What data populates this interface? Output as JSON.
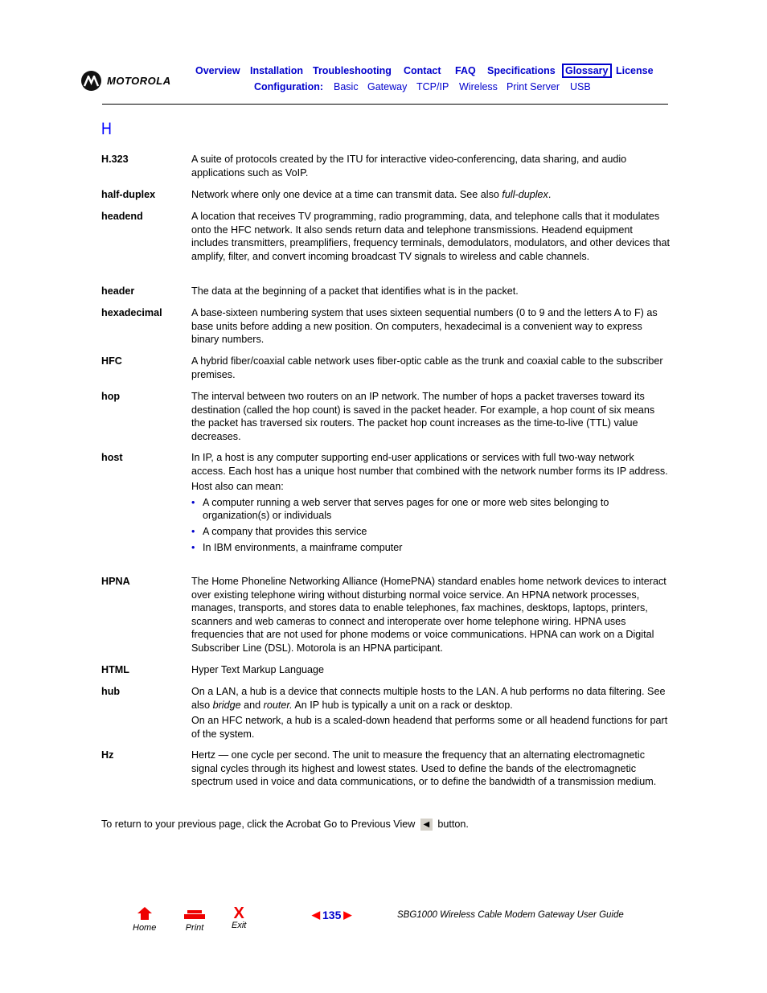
{
  "header": {
    "brand": "MOTOROLA",
    "nav_top": [
      {
        "label": "Overview"
      },
      {
        "label": "Installation"
      },
      {
        "label": "Troubleshooting"
      },
      {
        "label": "Contact"
      },
      {
        "label": "FAQ"
      },
      {
        "label": "Specifications"
      },
      {
        "label": "Glossary",
        "selected": true
      },
      {
        "label": "License"
      }
    ],
    "nav_config_label": "Configuration:",
    "nav_config": [
      {
        "label": "Basic"
      },
      {
        "label": "Gateway"
      },
      {
        "label": "TCP/IP"
      },
      {
        "label": "Wireless"
      },
      {
        "label": "Print Server"
      },
      {
        "label": "USB"
      }
    ]
  },
  "section_letter": "H",
  "entries": [
    {
      "term": "H.323",
      "paragraphs": [
        "A suite of protocols created by the ITU for interactive video-conferencing, data sharing, and audio applications such as VoIP."
      ]
    },
    {
      "term": "half-duplex",
      "paragraphs": [
        "Network where only one device at a time can transmit data. See also ",
        "full-duplex",
        "."
      ]
    },
    {
      "term": "headend",
      "paragraphs": [
        "A location that receives TV programming, radio programming, data, and telephone calls that it modulates onto the HFC network. It also sends return data and telephone transmissions. Headend equipment includes transmitters, preamplifiers, frequency terminals, demodulators, modulators, and other devices that amplify, filter, and convert incoming broadcast TV signals to wireless and cable channels."
      ]
    },
    {
      "term": "header",
      "paragraphs": [
        "The data at the beginning of a packet that identifies what is in the packet."
      ]
    },
    {
      "term": "hexadecimal",
      "paragraphs": [
        "A base-sixteen numbering system that uses sixteen sequential numbers (0 to 9 and the letters A to F) as base units before adding a new position. On computers, hexadecimal is a convenient way to express binary numbers."
      ]
    },
    {
      "term": "HFC",
      "paragraphs": [
        "A hybrid fiber/coaxial cable network uses fiber-optic cable as the trunk and coaxial cable to the subscriber premises."
      ]
    },
    {
      "term": "hop",
      "paragraphs": [
        "The interval between two routers on an IP network. The number of hops a packet traverses toward its destination (called the hop count) is saved in the packet header. For example, a hop count of six means the packet has traversed six routers. The packet hop count increases as the time-to-live (TTL) value decreases."
      ]
    },
    {
      "term": "host",
      "paragraphs": [
        "In IP, a host is any computer supporting end-user applications or services with full two-way network access. Each host has a unique host number that combined with the network number forms its IP address.",
        "Host also can mean:"
      ],
      "bullets": [
        "A computer running a web server that serves pages for one or more web sites belonging to organization(s) or individuals",
        "A company that provides this service",
        "In IBM environments, a mainframe computer"
      ]
    },
    {
      "term": "HPNA",
      "paragraphs": [
        "The Home Phoneline Networking Alliance (HomePNA) standard enables home network devices to interact over existing telephone wiring without disturbing normal voice service. An HPNA network processes, manages, transports, and stores data to enable telephones, fax machines, desktops, laptops, printers, scanners and web cameras to connect and interoperate over home telephone wiring. HPNA uses frequencies that are not used for phone modems or voice communications. HPNA can work on a Digital Subscriber Line (DSL). Motorola is an HPNA participant."
      ]
    },
    {
      "term": "HTML",
      "paragraphs": [
        "Hyper Text Markup Language"
      ]
    },
    {
      "term": "hub",
      "p1_a": "On a LAN, a hub is a device that connects multiple hosts to the LAN. A hub performs no data filtering. See also ",
      "p1_i1": "bridge",
      "p1_b": " and ",
      "p1_i2": "router.",
      "p1_c": " An IP hub is typically a unit on a rack or desktop.",
      "p2": "On an HFC network, a hub is a scaled-down headend that performs some or all headend functions for part of the system."
    },
    {
      "term": "Hz",
      "paragraphs": [
        "Hertz — one cycle per second. The unit to measure the frequency that an alternating electromagnetic signal cycles through its highest and lowest states. Used to define the bands of the electromagnetic spectrum used in voice and data communications, or to define the bandwidth of a transmission medium."
      ]
    }
  ],
  "return_note": {
    "before": "To return to your previous page, click the Acrobat Go to Previous View",
    "after": "button."
  },
  "footer": {
    "home": "Home",
    "print": "Print",
    "exit": "Exit",
    "page_number": "135",
    "guide_title": "SBG1000 Wireless Cable Modem Gateway User Guide"
  }
}
